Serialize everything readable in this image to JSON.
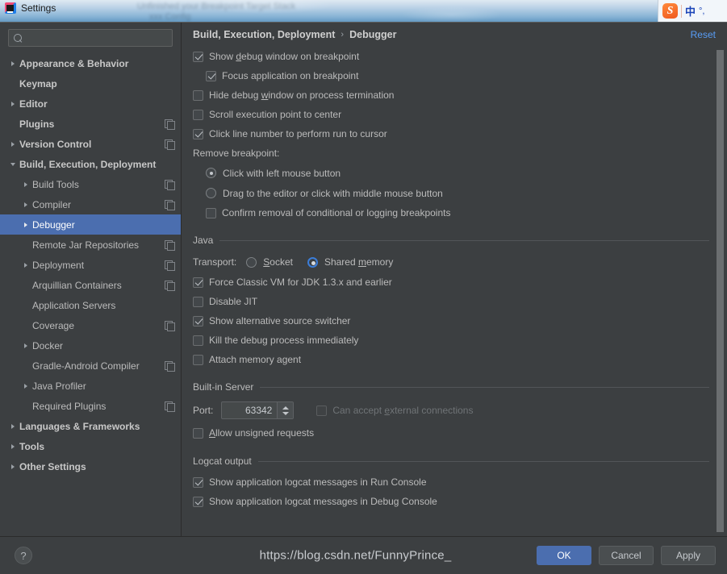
{
  "window": {
    "title": "Settings",
    "app_icon": "intellij-idea-icon"
  },
  "ime_bar": {
    "logo": "S",
    "mode": "中",
    "punctuation": "°,"
  },
  "search": {
    "value": "",
    "placeholder": "",
    "icon": "search-icon"
  },
  "sidebar": {
    "items": [
      {
        "label": "Appearance & Behavior",
        "level": 0,
        "bold": true,
        "arrow": "closed",
        "copy": false,
        "selected": false
      },
      {
        "label": "Keymap",
        "level": 0,
        "bold": true,
        "arrow": "none",
        "copy": false,
        "selected": false
      },
      {
        "label": "Editor",
        "level": 0,
        "bold": true,
        "arrow": "closed",
        "copy": false,
        "selected": false
      },
      {
        "label": "Plugins",
        "level": 0,
        "bold": true,
        "arrow": "none",
        "copy": true,
        "selected": false
      },
      {
        "label": "Version Control",
        "level": 0,
        "bold": true,
        "arrow": "closed",
        "copy": true,
        "selected": false
      },
      {
        "label": "Build, Execution, Deployment",
        "level": 0,
        "bold": true,
        "arrow": "open",
        "copy": false,
        "selected": false
      },
      {
        "label": "Build Tools",
        "level": 1,
        "bold": false,
        "arrow": "closed",
        "copy": true,
        "selected": false
      },
      {
        "label": "Compiler",
        "level": 1,
        "bold": false,
        "arrow": "closed",
        "copy": true,
        "selected": false
      },
      {
        "label": "Debugger",
        "level": 1,
        "bold": false,
        "arrow": "closed",
        "copy": false,
        "selected": true
      },
      {
        "label": "Remote Jar Repositories",
        "level": 1,
        "bold": false,
        "arrow": "none",
        "copy": true,
        "selected": false
      },
      {
        "label": "Deployment",
        "level": 1,
        "bold": false,
        "arrow": "closed",
        "copy": true,
        "selected": false
      },
      {
        "label": "Arquillian Containers",
        "level": 1,
        "bold": false,
        "arrow": "none",
        "copy": true,
        "selected": false
      },
      {
        "label": "Application Servers",
        "level": 1,
        "bold": false,
        "arrow": "none",
        "copy": false,
        "selected": false
      },
      {
        "label": "Coverage",
        "level": 1,
        "bold": false,
        "arrow": "none",
        "copy": true,
        "selected": false
      },
      {
        "label": "Docker",
        "level": 1,
        "bold": false,
        "arrow": "closed",
        "copy": false,
        "selected": false
      },
      {
        "label": "Gradle-Android Compiler",
        "level": 1,
        "bold": false,
        "arrow": "none",
        "copy": true,
        "selected": false
      },
      {
        "label": "Java Profiler",
        "level": 1,
        "bold": false,
        "arrow": "closed",
        "copy": false,
        "selected": false
      },
      {
        "label": "Required Plugins",
        "level": 1,
        "bold": false,
        "arrow": "none",
        "copy": true,
        "selected": false
      },
      {
        "label": "Languages & Frameworks",
        "level": 0,
        "bold": true,
        "arrow": "closed",
        "copy": false,
        "selected": false
      },
      {
        "label": "Tools",
        "level": 0,
        "bold": true,
        "arrow": "closed",
        "copy": false,
        "selected": false
      },
      {
        "label": "Other Settings",
        "level": 0,
        "bold": true,
        "arrow": "closed",
        "copy": false,
        "selected": false
      }
    ]
  },
  "breadcrumb": {
    "parent": "Build, Execution, Deployment",
    "separator": "›",
    "current": "Debugger",
    "reset_label": "Reset"
  },
  "debugger": {
    "top_options": [
      {
        "label": "Show debug window on breakpoint",
        "checked": true,
        "indent": false,
        "underline_at": 5
      },
      {
        "label": "Focus application on breakpoint",
        "checked": true,
        "indent": true,
        "underline_at": -1
      },
      {
        "label": "Hide debug window on process termination",
        "checked": false,
        "indent": false,
        "underline_at": 11
      },
      {
        "label": "Scroll execution point to center",
        "checked": false,
        "indent": false,
        "underline_at": -1
      },
      {
        "label": "Click line number to perform run to cursor",
        "checked": true,
        "indent": false,
        "underline_at": -1
      }
    ],
    "remove_breakpoint_label": "Remove breakpoint:",
    "remove_breakpoint_options": [
      {
        "label": "Click with left mouse button",
        "selected": true
      },
      {
        "label": "Drag to the editor or click with middle mouse button",
        "selected": false
      }
    ],
    "confirm_removal": {
      "label": "Confirm removal of conditional or logging breakpoints",
      "checked": false
    },
    "java_section_title": "Java",
    "transport_label": "Transport:",
    "transport_options": [
      {
        "label": "Socket",
        "selected": false,
        "underline_at": 0
      },
      {
        "label": "Shared memory",
        "selected": true,
        "underline_at": 7
      }
    ],
    "java_options": [
      {
        "label": "Force Classic VM for JDK 1.3.x and earlier",
        "checked": true
      },
      {
        "label": "Disable JIT",
        "checked": false
      },
      {
        "label": "Show alternative source switcher",
        "checked": true
      },
      {
        "label": "Kill the debug process immediately",
        "checked": false
      },
      {
        "label": "Attach memory agent",
        "checked": false
      }
    ],
    "builtin_server_title": "Built-in Server",
    "port_label": "Port:",
    "port_value": "63342",
    "external_connections": {
      "label": "Can accept external connections",
      "checked": false,
      "disabled": true
    },
    "allow_unsigned": {
      "label": "Allow unsigned requests",
      "checked": false
    },
    "logcat_title": "Logcat output",
    "logcat_options": [
      {
        "label": "Show application logcat messages in Run Console",
        "checked": true
      },
      {
        "label": "Show application logcat messages in Debug Console",
        "checked": true
      }
    ]
  },
  "footer": {
    "help_label": "?",
    "buttons": [
      {
        "label": "OK",
        "primary": true
      },
      {
        "label": "Cancel",
        "primary": false
      },
      {
        "label": "Apply",
        "primary": false
      }
    ],
    "watermark": "https://blog.csdn.net/FunnyPrince_"
  },
  "colors": {
    "accent": "#4b6eaf",
    "link": "#589df6",
    "panel_bg": "#3c3f41",
    "text": "#bbbbbb",
    "radio_focus": "#3b7dd8"
  }
}
